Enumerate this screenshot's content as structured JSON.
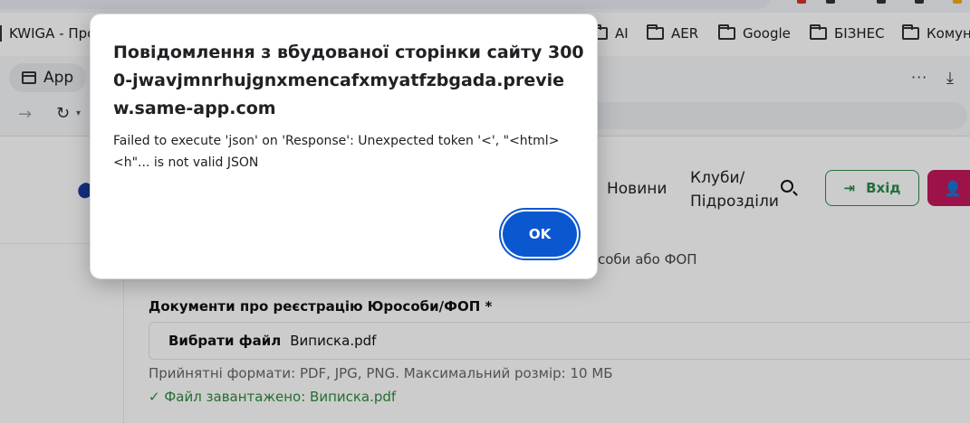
{
  "browser": {
    "bookmarks": [
      {
        "label": "KWIGA - Про"
      },
      {
        "label": "AI"
      },
      {
        "label": "AER"
      },
      {
        "label": "Google"
      },
      {
        "label": "БІЗНЕС"
      },
      {
        "label": "Комуна"
      }
    ],
    "app_tab_label": "App",
    "more_label": "···"
  },
  "site": {
    "nav": {
      "news": "Новини",
      "clubs": "Клуби/ Підрозділи",
      "login": "Вхід"
    },
    "form": {
      "partial_label": "соби або ФОП",
      "doc_label": "Документи про реєстрацію Юрособи/ФОП *",
      "file_button": "Вибрати файл",
      "file_name": "Виписка.pdf",
      "hint": "Прийнятні формати: PDF, JPG, PNG. Максимальний розмір: 10 МБ",
      "uploaded": "✓ Файл завантажено: Виписка.pdf"
    }
  },
  "dialog": {
    "title": "Повідомлення з вбудованої сторінки сайту 3000-jwavjmnrhujgnxmencafxmyatfzbgada.preview.same-app.com",
    "message": "Failed to execute 'json' on 'Response': Unexpected token '<', \"<html> <h\"... is not valid JSON",
    "ok_label": "OK",
    "accent_color": "#0b57d0"
  },
  "colors": {
    "login_green": "#2a8a4a",
    "user_pink": "#c2185b",
    "success_green": "#2e8b3e"
  }
}
